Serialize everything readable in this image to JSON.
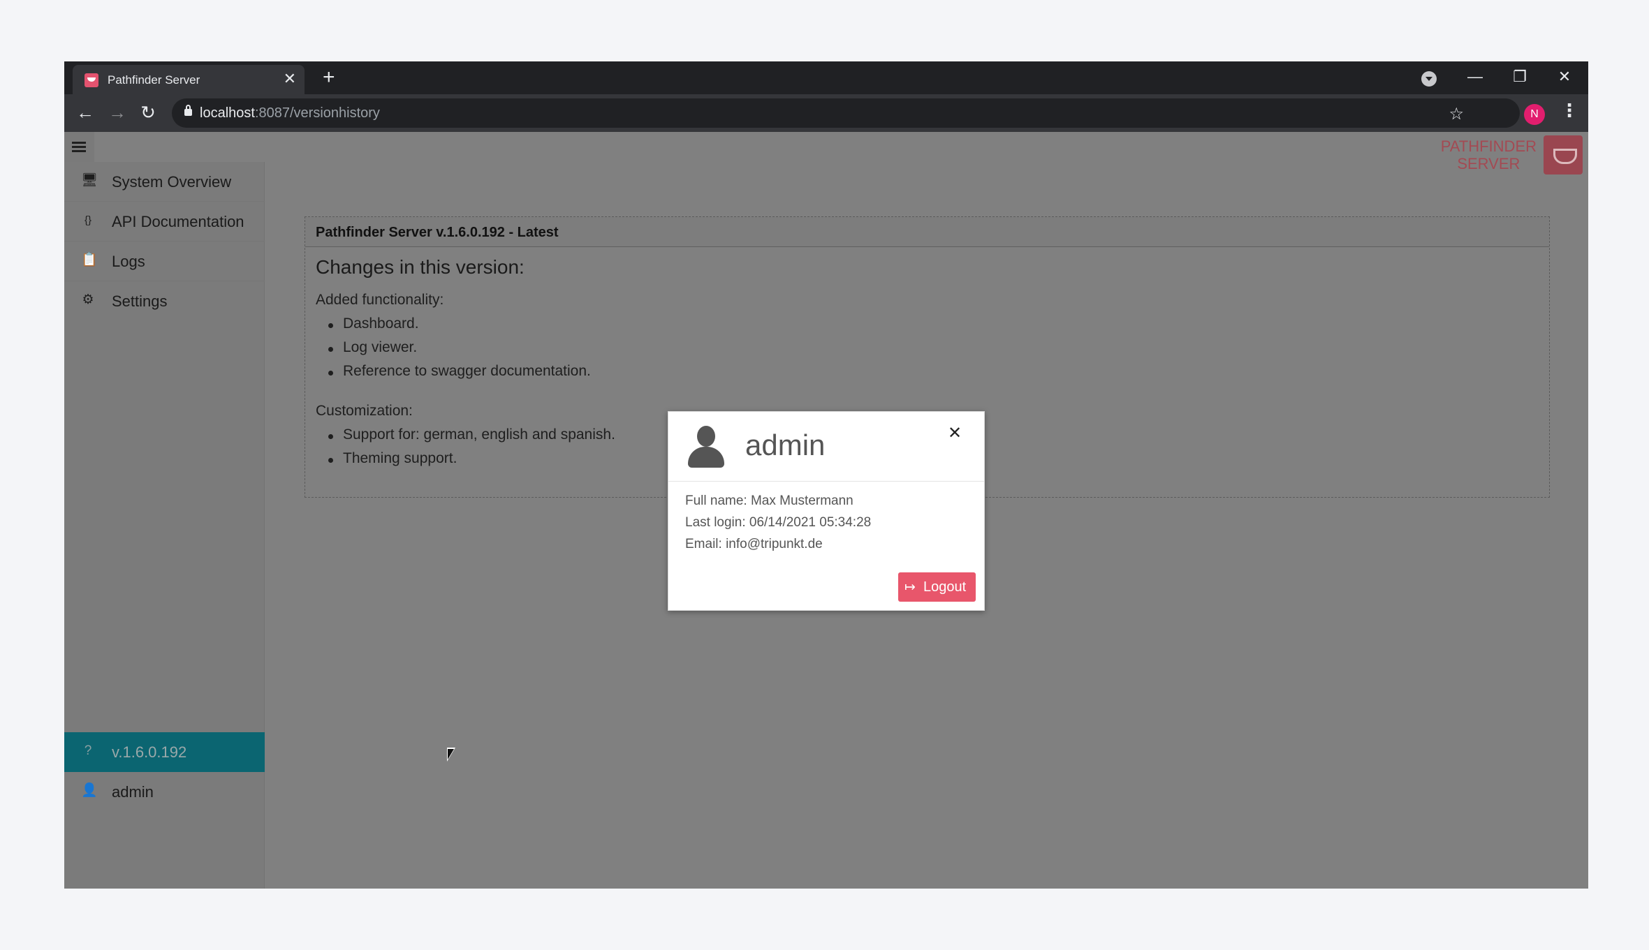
{
  "browser": {
    "tab_title": "Pathfinder Server",
    "tab_close": "✕",
    "new_tab": "+",
    "url_host": "localhost",
    "url_path": ":8087/versionhistory",
    "profile_initial": "N",
    "window_controls": {
      "minimize": "—",
      "restore": "❐",
      "close": "✕"
    }
  },
  "header": {
    "logo_line1": "PATHFINDER",
    "logo_line2": "SERVER"
  },
  "sidebar": {
    "items": [
      {
        "label": "System Overview",
        "icon": "monitor-icon",
        "glyph": "🖥"
      },
      {
        "label": "API Documentation",
        "icon": "code-braces-icon",
        "glyph": "{}"
      },
      {
        "label": "Logs",
        "icon": "clipboard-icon",
        "glyph": "📋"
      },
      {
        "label": "Settings",
        "icon": "gear-icon",
        "glyph": "⚙"
      }
    ],
    "version": "v.1.6.0.192",
    "user": "admin"
  },
  "content": {
    "card_header": "Pathfinder Server v.1.6.0.192 - Latest",
    "changes_title": "Changes in this version:",
    "added_label": "Added functionality:",
    "added_items": [
      "Dashboard.",
      "Log viewer.",
      "Reference to swagger documentation."
    ],
    "custom_label": "Customization:",
    "custom_items": [
      "Support for: german, english and spanish.",
      "Theming support."
    ]
  },
  "modal": {
    "title": "admin",
    "close": "✕",
    "full_name": "Full name: Max Mustermann",
    "last_login": "Last login: 06/14/2021 05:34:28",
    "email": "Email: info@tripunkt.de",
    "logout_label": "Logout"
  },
  "colors": {
    "accent": "#e8566b",
    "version_bar": "#0b6571",
    "overlay": "#808080"
  }
}
